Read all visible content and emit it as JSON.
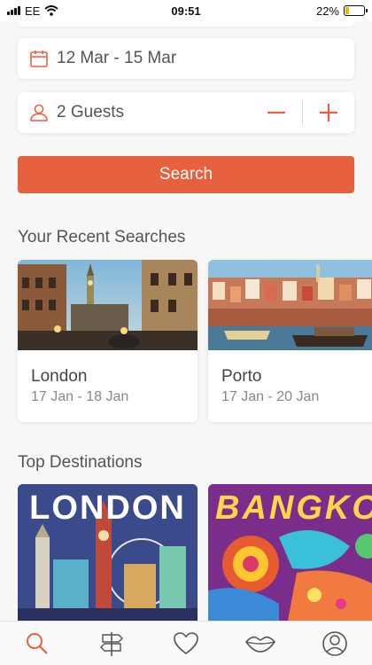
{
  "status_bar": {
    "carrier": "EE",
    "time": "09:51",
    "battery_percent": "22%",
    "battery_level": 0.22
  },
  "search_form": {
    "dates_value": "12 Mar - 15 Mar",
    "guests_value": "2 Guests",
    "search_label": "Search",
    "icons": {
      "calendar": "calendar-icon",
      "person": "person-icon",
      "minus": "minus-icon",
      "plus": "plus-icon"
    }
  },
  "recent_searches": {
    "title": "Your Recent Searches",
    "items": [
      {
        "city": "London",
        "dates": "17 Jan - 18 Jan"
      },
      {
        "city": "Porto",
        "dates": "17 Jan - 20 Jan"
      }
    ]
  },
  "top_destinations": {
    "title": "Top Destinations",
    "items": [
      {
        "label": "LONDON"
      },
      {
        "label": "BANGKOK"
      }
    ]
  },
  "tab_bar": {
    "items": [
      "search-icon",
      "signpost-icon",
      "heart-icon",
      "lips-icon",
      "profile-icon"
    ]
  },
  "colors": {
    "accent": "#e8613e",
    "background": "#f7f7f7",
    "card": "#ffffff",
    "muted_text": "#888888"
  }
}
